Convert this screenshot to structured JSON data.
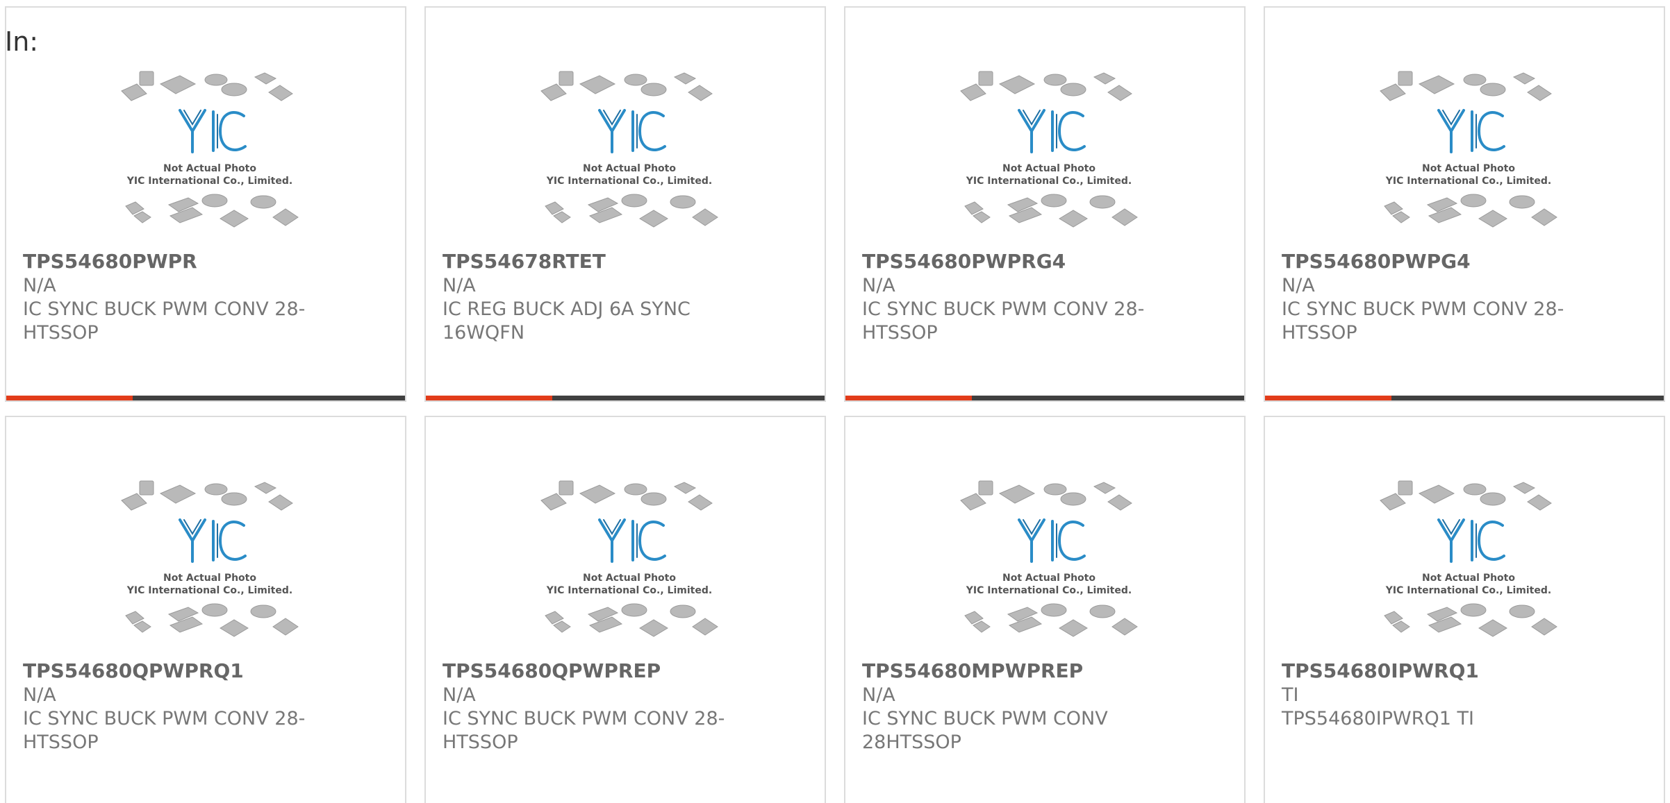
{
  "filter_label": "In:",
  "watermark": {
    "logo": "YIC",
    "line1": "Not Actual Photo",
    "line2": "YIC International Co., Limited."
  },
  "colors": {
    "accent": "#e23c1a",
    "bar": "#404040",
    "logo_blue": "#2a8cc7"
  },
  "products": [
    {
      "part_number": "TPS54680PWPR",
      "brand": "N/A",
      "description": "IC SYNC BUCK PWM CONV 28-HTSSOP"
    },
    {
      "part_number": "TPS54678RTET",
      "brand": "N/A",
      "description": "IC REG BUCK ADJ 6A SYNC 16WQFN"
    },
    {
      "part_number": "TPS54680PWPRG4",
      "brand": "N/A",
      "description": "IC SYNC BUCK PWM CONV 28-HTSSOP"
    },
    {
      "part_number": "TPS54680PWPG4",
      "brand": "N/A",
      "description": "IC SYNC BUCK PWM CONV 28-HTSSOP"
    },
    {
      "part_number": "TPS54680QPWPRQ1",
      "brand": "N/A",
      "description": "IC SYNC BUCK PWM CONV 28-HTSSOP"
    },
    {
      "part_number": "TPS54680QPWPREP",
      "brand": "N/A",
      "description": "IC SYNC BUCK PWM CONV 28-HTSSOP"
    },
    {
      "part_number": "TPS54680MPWPREP",
      "brand": "N/A",
      "description": "IC SYNC BUCK PWM CONV 28HTSSOP"
    },
    {
      "part_number": "TPS54680IPWRQ1",
      "brand": "TI",
      "description": "TPS54680IPWRQ1 TI"
    }
  ]
}
